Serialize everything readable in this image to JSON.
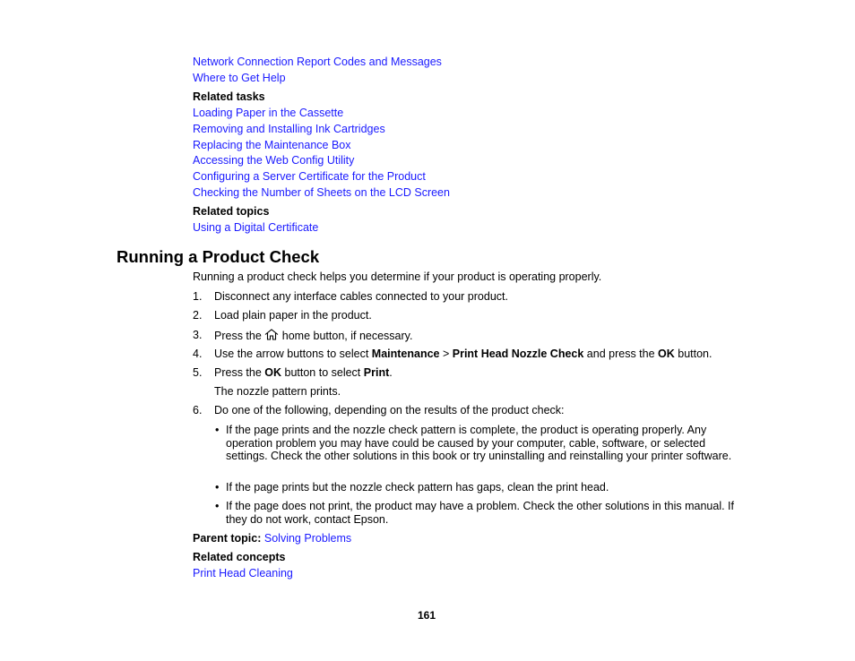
{
  "links_top": [
    "Network Connection Report Codes and Messages",
    "Where to Get Help"
  ],
  "related_tasks": {
    "heading": "Related tasks",
    "links": [
      "Loading Paper in the Cassette",
      "Removing and Installing Ink Cartridges",
      "Replacing the Maintenance Box",
      "Accessing the Web Config Utility",
      "Configuring a Server Certificate for the Product",
      "Checking the Number of Sheets on the LCD Screen"
    ]
  },
  "related_topics": {
    "heading": "Related topics",
    "links": [
      "Using a Digital Certificate"
    ]
  },
  "section": {
    "title": "Running a Product Check",
    "intro": "Running a product check helps you determine if your product is operating properly.",
    "steps": [
      {
        "num": "1.",
        "text": "Disconnect any interface cables connected to your product."
      },
      {
        "num": "2.",
        "text": "Load plain paper in the product."
      },
      {
        "num": "3.",
        "pre": "Press the",
        "icon": "home-icon",
        "post": "home button, if necessary."
      },
      {
        "num": "4.",
        "t1": "Use the arrow buttons to select ",
        "b1": "Maintenance",
        "t2": " > ",
        "b2": "Print Head Nozzle Check",
        "t3": " and press the ",
        "b3": "OK",
        "t4": " button."
      },
      {
        "num": "5.",
        "t1": "Press the ",
        "b1": "OK",
        "t2": " button to select ",
        "b2": "Print",
        "t3": ".",
        "note": "The nozzle pattern prints."
      },
      {
        "num": "6.",
        "text": "Do one of the following, depending on the results of the product check:"
      }
    ],
    "bullets": [
      "If the page prints and the nozzle check pattern is complete, the product is operating properly. Any operation problem you may have could be caused by your computer, cable, software, or selected settings. Check the other solutions in this book or try uninstalling and reinstalling your printer software.",
      "If the page prints but the nozzle check pattern has gaps, clean the print head.",
      "If the page does not print, the product may have a problem. Check the other solutions in this manual. If they do not work, contact Epson."
    ],
    "bullet_char": "•"
  },
  "parent_topic": {
    "label": "Parent topic:",
    "link": "Solving Problems"
  },
  "related_concepts": {
    "heading": "Related concepts",
    "links": [
      "Print Head Cleaning"
    ]
  },
  "page_number": "161",
  "colors": {
    "link": "#1a1aff",
    "text": "#000000"
  }
}
